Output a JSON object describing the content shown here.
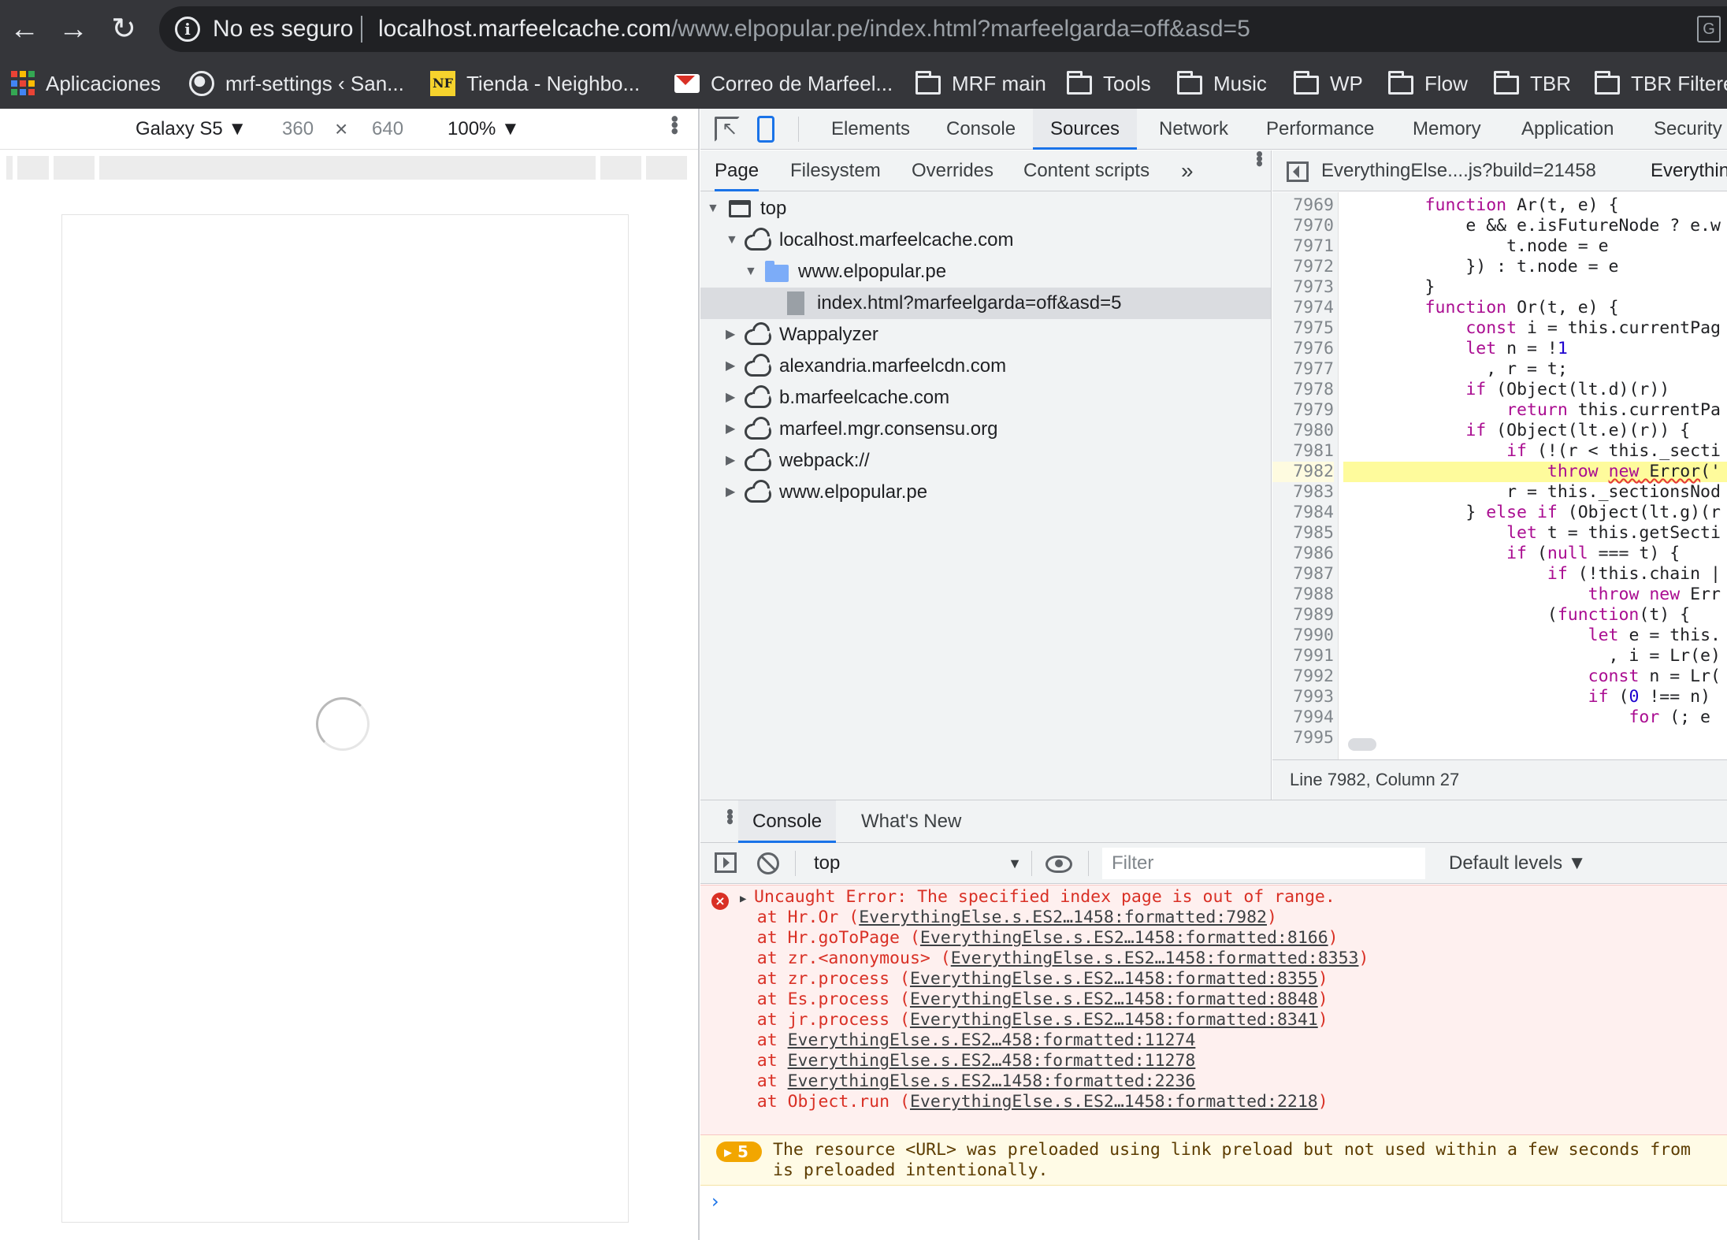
{
  "browser": {
    "security_label": "No es seguro",
    "url_host": "localhost.marfeelcache.com",
    "url_path": "/www.elpopular.pe/index.html?marfeelgarda=off&asd=5",
    "translate_icon": "translate-icon",
    "bookmarks": [
      {
        "label": "Aplicaciones",
        "icon": "apps-icon"
      },
      {
        "label": "mrf-settings ‹ San...",
        "icon": "globe-icon"
      },
      {
        "label": "Tienda - Neighbo...",
        "icon": "nf-icon"
      },
      {
        "label": "Correo de Marfeel...",
        "icon": "gmail-icon"
      },
      {
        "label": "MRF main",
        "icon": "folder-icon"
      },
      {
        "label": "Tools",
        "icon": "folder-icon"
      },
      {
        "label": "Music",
        "icon": "folder-icon"
      },
      {
        "label": "WP",
        "icon": "folder-icon"
      },
      {
        "label": "Flow",
        "icon": "folder-icon"
      },
      {
        "label": "TBR",
        "icon": "folder-icon"
      },
      {
        "label": "TBR Filtere",
        "icon": "folder-icon"
      }
    ]
  },
  "device_toolbar": {
    "device": "Galaxy S5 ▼",
    "width": "360",
    "times": "×",
    "height": "640",
    "zoom": "100% ▼"
  },
  "devtools": {
    "main_tabs": [
      "Elements",
      "Console",
      "Sources",
      "Network",
      "Performance",
      "Memory",
      "Application",
      "Security"
    ],
    "active_main_tab": "Sources",
    "navigator_tabs": [
      "Page",
      "Filesystem",
      "Overrides",
      "Content scripts"
    ],
    "navigator_more": "»",
    "tree": [
      {
        "label": "top"
      },
      {
        "label": "localhost.marfeelcache.com"
      },
      {
        "label": "www.elpopular.pe"
      },
      {
        "label": "index.html?marfeelgarda=off&asd=5"
      },
      {
        "label": "Wappalyzer"
      },
      {
        "label": "alexandria.marfeelcdn.com"
      },
      {
        "label": "b.marfeelcache.com"
      },
      {
        "label": "marfeel.mgr.consensu.org"
      },
      {
        "label": "webpack://"
      },
      {
        "label": "www.elpopular.pe"
      }
    ],
    "editor_tabs": [
      "EverythingElse....js?build=21458",
      "Everythin"
    ],
    "code_lines": [
      {
        "n": "7969",
        "t": "        function Ar(t, e) {"
      },
      {
        "n": "7970",
        "t": "            e && e.isFutureNode ? e.w"
      },
      {
        "n": "7971",
        "t": "                t.node = e"
      },
      {
        "n": "7972",
        "t": "            }) : t.node = e"
      },
      {
        "n": "7973",
        "t": "        }"
      },
      {
        "n": "7974",
        "t": "        function Or(t, e) {"
      },
      {
        "n": "7975",
        "t": "            const i = this.currentPag"
      },
      {
        "n": "7976",
        "t": "            let n = !1"
      },
      {
        "n": "7977",
        "t": "              , r = t;"
      },
      {
        "n": "7978",
        "t": "            if (Object(lt.d)(r))"
      },
      {
        "n": "7979",
        "t": "                return this.currentPa"
      },
      {
        "n": "7980",
        "t": "            if (Object(lt.e)(r)) {"
      },
      {
        "n": "7981",
        "t": "                if (!(r < this._secti"
      },
      {
        "n": "7982",
        "t": "                    throw new Error('"
      },
      {
        "n": "7983",
        "t": "                r = this._sectionsNod"
      },
      {
        "n": "7984",
        "t": "            } else if (Object(lt.g)(r"
      },
      {
        "n": "7985",
        "t": "                let t = this.getSecti"
      },
      {
        "n": "7986",
        "t": "                if (null === t) {"
      },
      {
        "n": "7987",
        "t": "                    if (!this.chain |"
      },
      {
        "n": "7988",
        "t": "                        throw new Err"
      },
      {
        "n": "7989",
        "t": "                    (function(t) {"
      },
      {
        "n": "7990",
        "t": "                        let e = this."
      },
      {
        "n": "7991",
        "t": "                          , i = Lr(e)"
      },
      {
        "n": "7992",
        "t": "                        const n = Lr("
      },
      {
        "n": "7993",
        "t": "                        if (0 !== n)"
      },
      {
        "n": "7994",
        "t": "                            for (; e"
      },
      {
        "n": "7995",
        "t": ""
      }
    ],
    "highlighted_line": "7982",
    "status": "Line 7982, Column 27",
    "drawer_tabs": [
      "Console",
      "What's New"
    ],
    "console_context": "top",
    "filter_placeholder": "Filter",
    "levels": "Default levels ▼",
    "error": {
      "message": "Uncaught Error: The specified index page is out of range.",
      "stack": [
        {
          "pre": "    at Hr.Or (",
          "link": "EverythingElse.s.ES2…1458:formatted:7982",
          "post": ")"
        },
        {
          "pre": "    at Hr.goToPage (",
          "link": "EverythingElse.s.ES2…1458:formatted:8166",
          "post": ")"
        },
        {
          "pre": "    at zr.<anonymous> (",
          "link": "EverythingElse.s.ES2…1458:formatted:8353",
          "post": ")"
        },
        {
          "pre": "    at zr.process (",
          "link": "EverythingElse.s.ES2…1458:formatted:8355",
          "post": ")"
        },
        {
          "pre": "    at Es.process (",
          "link": "EverythingElse.s.ES2…1458:formatted:8848",
          "post": ")"
        },
        {
          "pre": "    at jr.process (",
          "link": "EverythingElse.s.ES2…1458:formatted:8341",
          "post": ")"
        },
        {
          "pre": "    at ",
          "link": "EverythingElse.s.ES2…458:formatted:11274",
          "post": ""
        },
        {
          "pre": "    at ",
          "link": "EverythingElse.s.ES2…458:formatted:11278",
          "post": ""
        },
        {
          "pre": "    at ",
          "link": "EverythingElse.s.ES2…1458:formatted:2236",
          "post": ""
        },
        {
          "pre": "    at Object.run (",
          "link": "EverythingElse.s.ES2…1458:formatted:2218",
          "post": ")"
        }
      ]
    },
    "warning": {
      "count": "5",
      "line1": "The resource <URL> was preloaded using link preload but not used within a few seconds from",
      "line2": "is preloaded intentionally."
    },
    "prompt": "›"
  }
}
